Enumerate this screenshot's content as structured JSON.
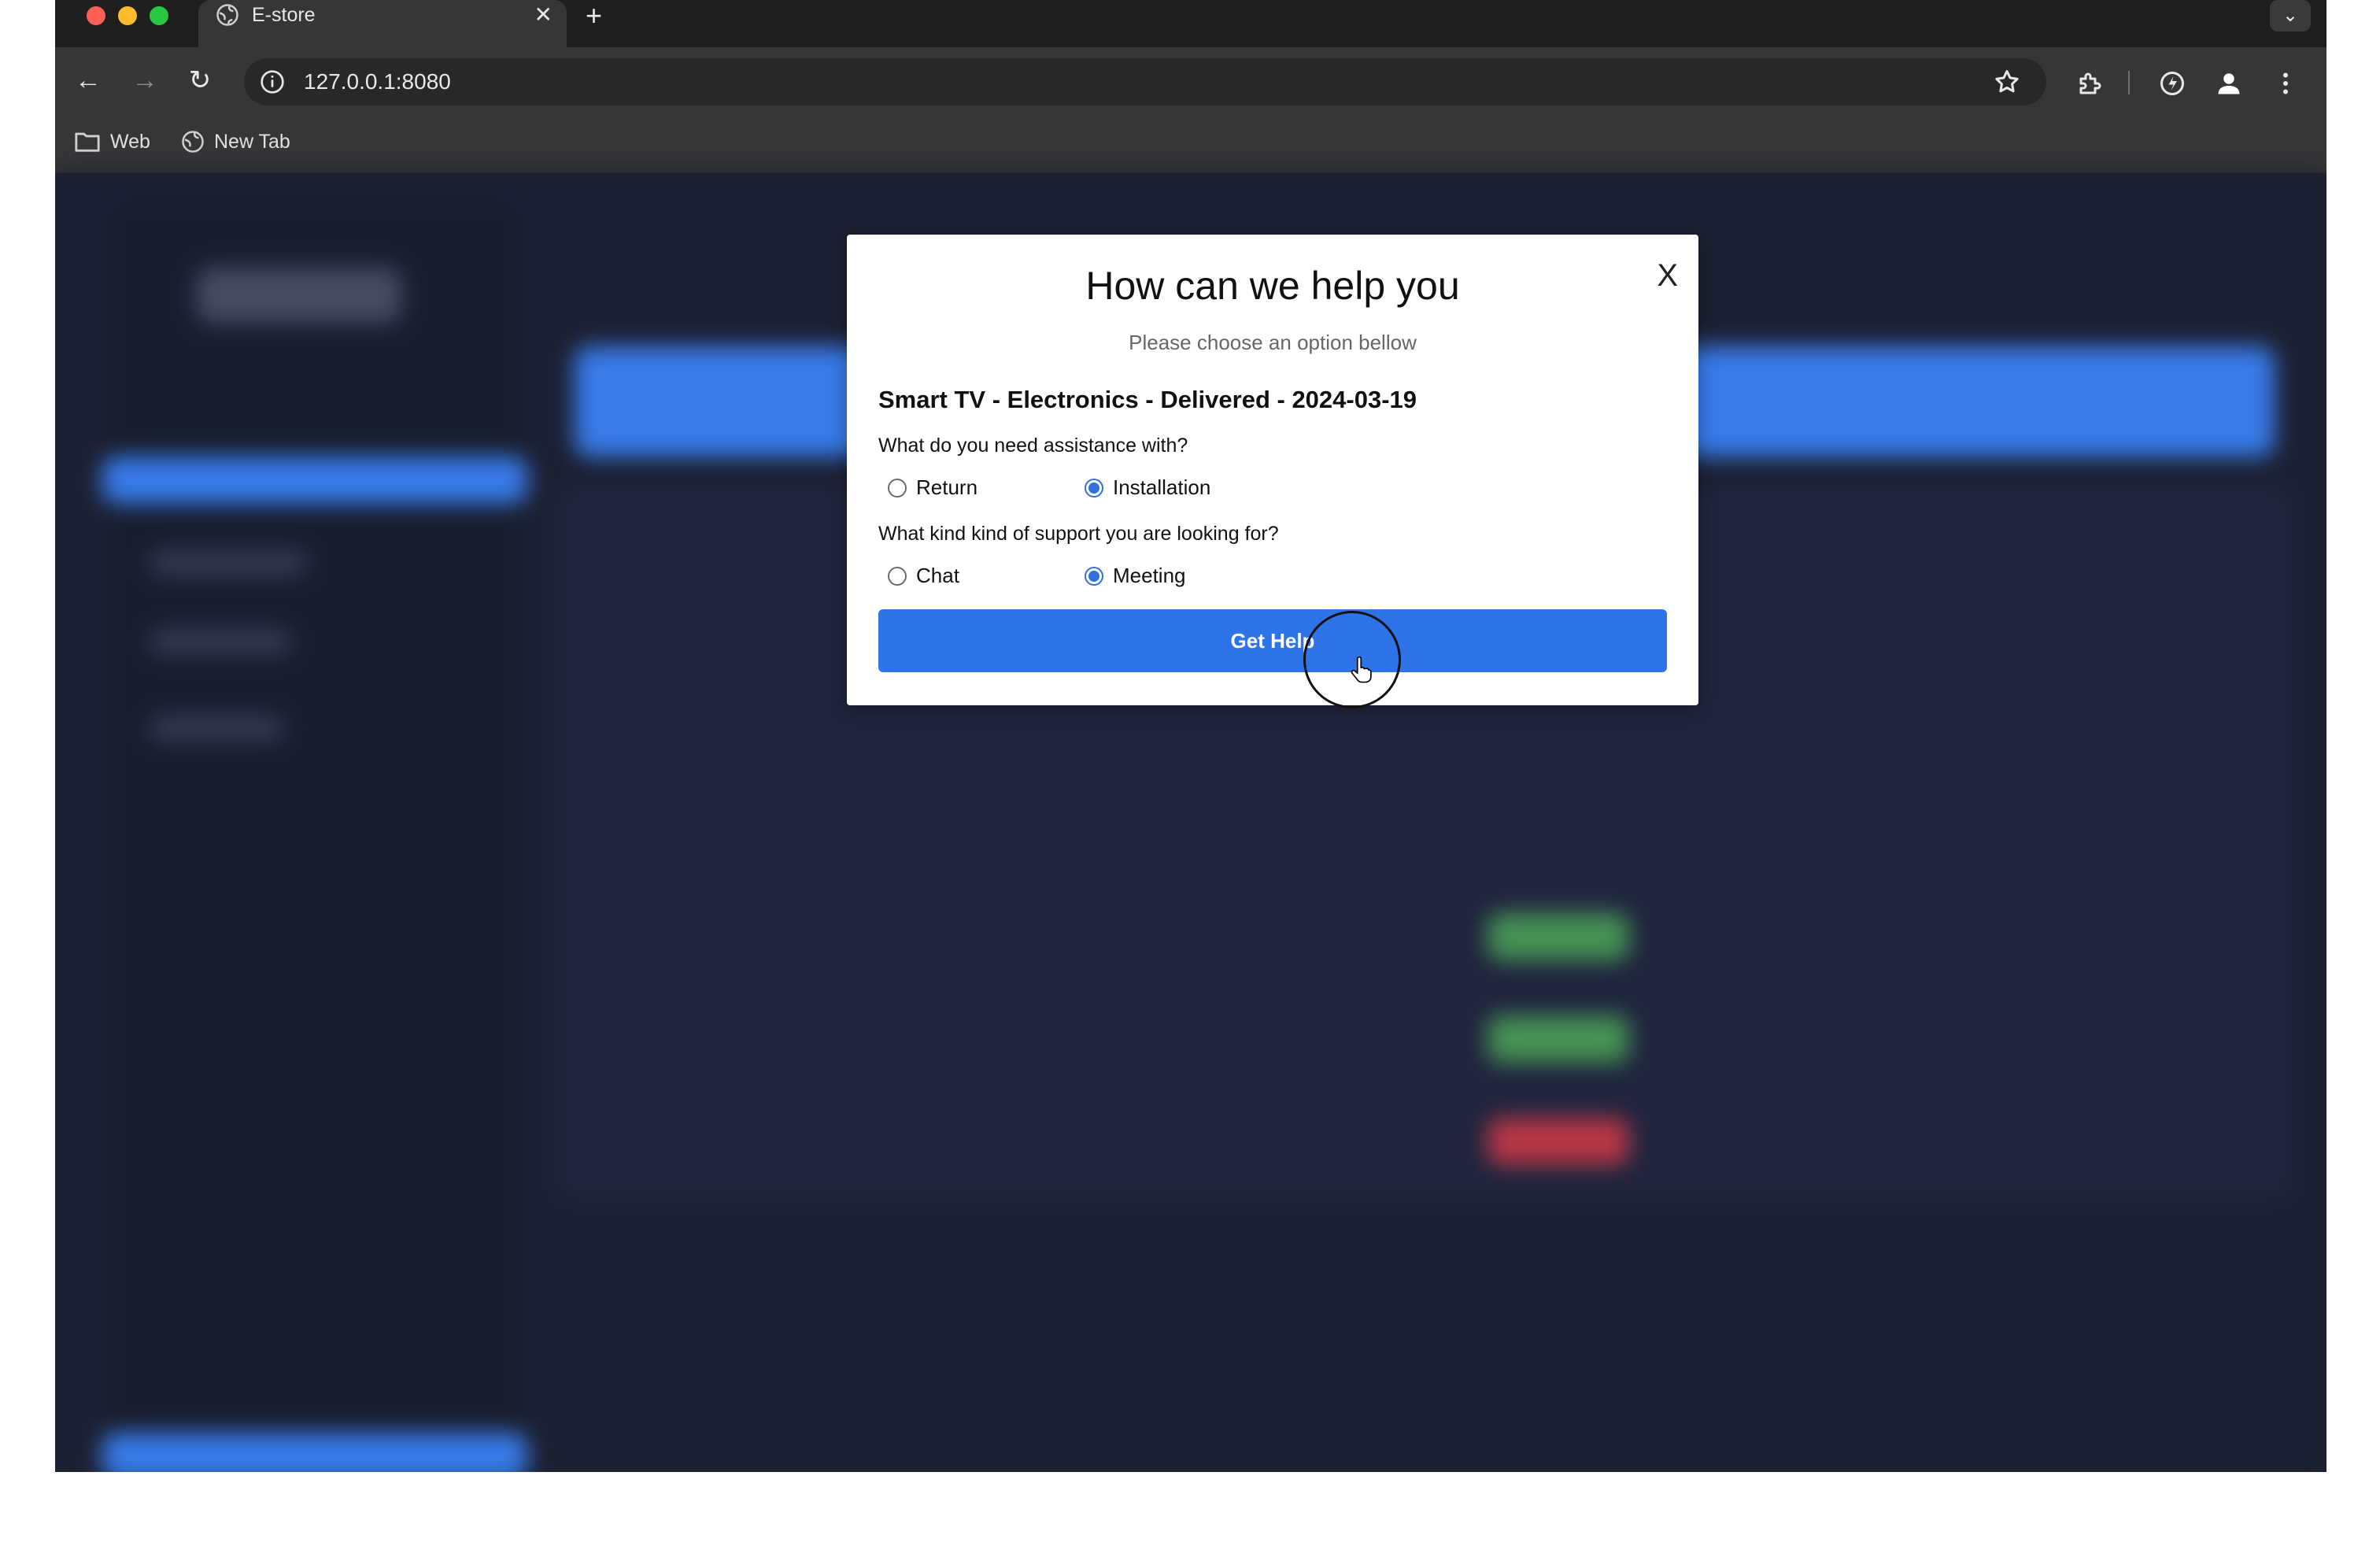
{
  "browser": {
    "tab_title": "E-store",
    "tab_close": "✕",
    "new_tab": "+",
    "tabs_menu": "⌄",
    "url": "127.0.0.1:8080",
    "bookmarks": [
      {
        "label": "Web",
        "icon": "folder-icon"
      },
      {
        "label": "New Tab",
        "icon": "globe-icon"
      }
    ]
  },
  "modal": {
    "close_label": "X",
    "title": "How can we help you",
    "subtitle": "Please choose an option bellow",
    "product": "Smart TV - Electronics - Delivered - 2024-03-19",
    "question1": "What do you need assistance with?",
    "question1_options": [
      {
        "label": "Return",
        "checked": false
      },
      {
        "label": "Installation",
        "checked": true
      }
    ],
    "question2": "What kind kind of support you are looking for?",
    "question2_options": [
      {
        "label": "Chat",
        "checked": false
      },
      {
        "label": "Meeting",
        "checked": true
      }
    ],
    "submit_label": "Get Help"
  },
  "colors": {
    "accent": "#2f73e8",
    "radio_checked": "#2f6fe0",
    "app_background": "#1d2235"
  }
}
